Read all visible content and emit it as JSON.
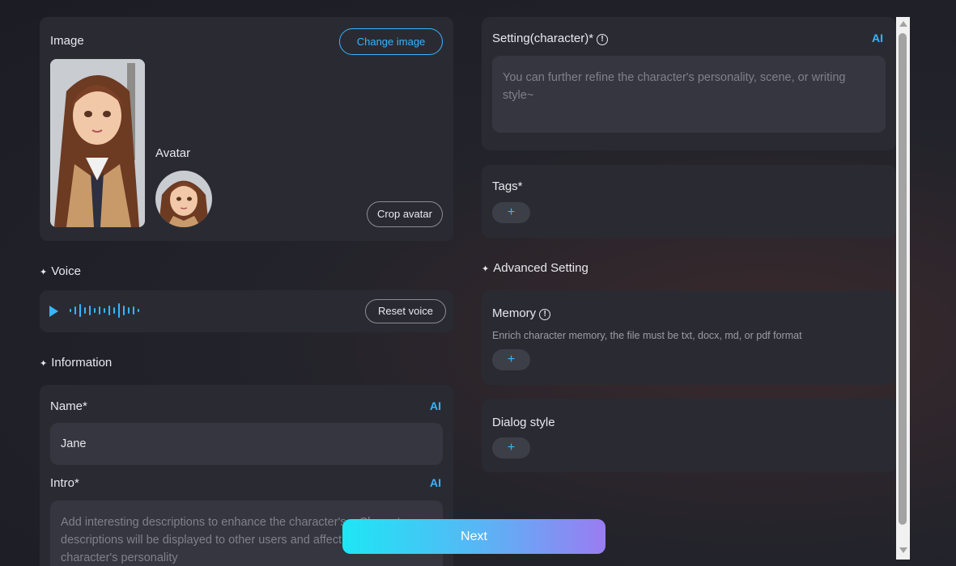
{
  "image_card": {
    "label": "Image",
    "change_image": "Change image",
    "avatar_label": "Avatar",
    "crop_avatar": "Crop avatar"
  },
  "voice": {
    "title": "Voice",
    "reset": "Reset voice"
  },
  "information": {
    "title": "Information",
    "name_label": "Name*",
    "name_value": "Jane",
    "intro_label": "Intro*",
    "intro_placeholder": "Add interesting descriptions to enhance the character's... Character descriptions will be displayed to other users and affect the character's personality",
    "ai": "AI"
  },
  "setting": {
    "label": "Setting(character)*",
    "placeholder": "You can further refine the character's personality, scene, or writing style~",
    "ai": "AI"
  },
  "tags": {
    "label": "Tags*",
    "add": "+"
  },
  "advanced": {
    "title": "Advanced Setting",
    "memory_label": "Memory",
    "memory_desc": "Enrich character memory, the file must be txt, docx, md, or pdf format",
    "memory_add": "+",
    "dialog_label": "Dialog style",
    "dialog_add": "+"
  },
  "next": "Next",
  "colors": {
    "accent": "#35b6ff",
    "card": "#2a2b32",
    "next_start": "#1ee6f5",
    "next_end": "#9a7cf2"
  }
}
